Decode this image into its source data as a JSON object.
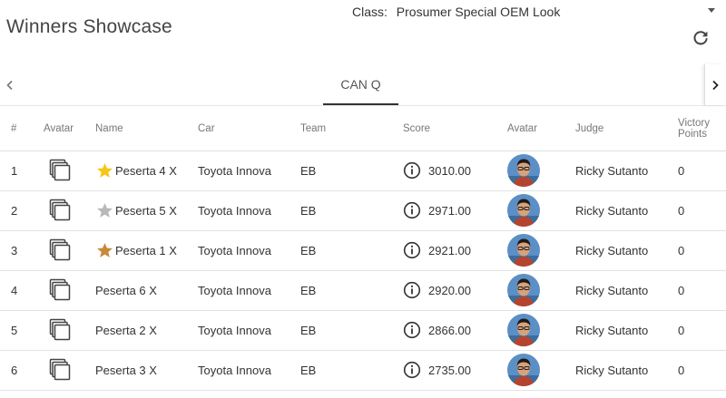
{
  "header": {
    "title": "Winners Showcase",
    "class_label": "Class:",
    "class_value": "Prosumer Special OEM Look"
  },
  "tabs": [
    {
      "label": "CAN Q",
      "active": true
    }
  ],
  "table": {
    "headers": {
      "num": "#",
      "avatar": "Avatar",
      "name": "Name",
      "car": "Car",
      "team": "Team",
      "score": "Score",
      "avatar2": "Avatar",
      "judge": "Judge",
      "victory_1": "Victory",
      "victory_2": "Points"
    },
    "rows": [
      {
        "rank": "1",
        "name": "Peserta 4 X",
        "car": "Toyota Innova",
        "team": "EB",
        "score": "3010.00",
        "judge": "Ricky Sutanto",
        "points": "0",
        "star": "gold"
      },
      {
        "rank": "2",
        "name": "Peserta 5 X",
        "car": "Toyota Innova",
        "team": "EB",
        "score": "2971.00",
        "judge": "Ricky Sutanto",
        "points": "0",
        "star": "silver"
      },
      {
        "rank": "3",
        "name": "Peserta 1 X",
        "car": "Toyota Innova",
        "team": "EB",
        "score": "2921.00",
        "judge": "Ricky Sutanto",
        "points": "0",
        "star": "bronze"
      },
      {
        "rank": "4",
        "name": "Peserta 6 X",
        "car": "Toyota Innova",
        "team": "EB",
        "score": "2920.00",
        "judge": "Ricky Sutanto",
        "points": "0",
        "star": ""
      },
      {
        "rank": "5",
        "name": "Peserta 2 X",
        "car": "Toyota Innova",
        "team": "EB",
        "score": "2866.00",
        "judge": "Ricky Sutanto",
        "points": "0",
        "star": ""
      },
      {
        "rank": "6",
        "name": "Peserta 3 X",
        "car": "Toyota Innova",
        "team": "EB",
        "score": "2735.00",
        "judge": "Ricky Sutanto",
        "points": "0",
        "star": ""
      }
    ]
  },
  "colors": {
    "gold": "#f5c518",
    "silver": "#b8b8b8",
    "bronze": "#c8883a",
    "tab_underline": "#333333"
  },
  "icons": {
    "refresh": "refresh-icon",
    "tab_prev": "chevron-left-icon",
    "tab_next": "chevron-right-icon",
    "avatar_placeholder": "photo-stack-icon",
    "score_info": "info-icon",
    "judge_avatar": "judge-photo"
  }
}
